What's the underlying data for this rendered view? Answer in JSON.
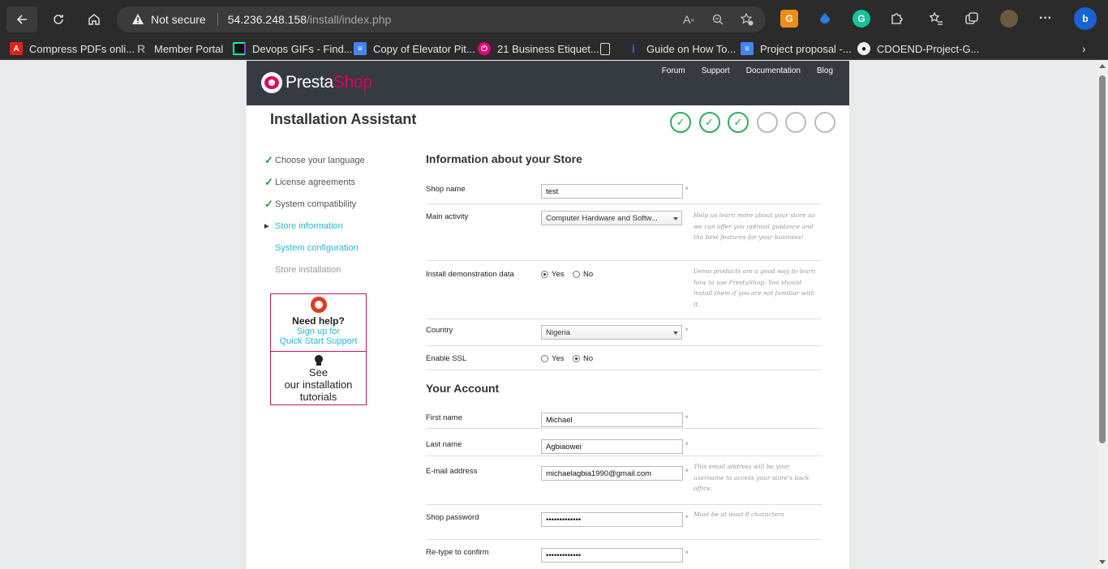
{
  "browser": {
    "security_label": "Not secure",
    "url_host": "54.236.248.158",
    "url_path": "/install/index.php",
    "bookmarks": [
      {
        "label": "Compress PDFs onli...",
        "icon": "acrobat-icon",
        "color": "#e0201a"
      },
      {
        "label": "Member Portal",
        "icon": "r-logo-icon",
        "color": "#555555"
      },
      {
        "label": "Devops GIFs - Find...",
        "icon": "giphy-icon",
        "color": "#1a1a1a"
      },
      {
        "label": "Copy of Elevator Pit...",
        "icon": "docs-icon",
        "color": "#4285f4"
      },
      {
        "label": "21 Business Etiquet...",
        "icon": "power-icon",
        "color": "#e6007e"
      },
      {
        "label": "",
        "icon": "file-icon",
        "color": "#2b2b2b"
      },
      {
        "label": "Guide on How To...",
        "icon": "info-icon",
        "color": "#1a73e8"
      },
      {
        "label": "Project proposal -...",
        "icon": "docs-icon",
        "color": "#4285f4"
      },
      {
        "label": "CDOEND-Project-G...",
        "icon": "github-icon",
        "color": "#f0f0f0"
      }
    ]
  },
  "header": {
    "logo_part1": "Presta",
    "logo_part2": "Shop",
    "links": [
      "Forum",
      "Support",
      "Documentation",
      "Blog"
    ]
  },
  "page_title": "Installation Assistant",
  "progress": {
    "completed_steps": 3,
    "total_steps": 6
  },
  "sidenav": [
    {
      "label": "Choose your language",
      "state": "done"
    },
    {
      "label": "License agreements",
      "state": "done"
    },
    {
      "label": "System compatibility",
      "state": "done"
    },
    {
      "label": "Store information",
      "state": "current"
    },
    {
      "label": "System configuration",
      "state": "next"
    },
    {
      "label": "Store installation",
      "state": "later"
    }
  ],
  "help": {
    "title": "Need help?",
    "link_line1": "Sign up for",
    "link_line2": "Quick Start Support",
    "tutorial_line1": "See",
    "tutorial_line2": "our installation",
    "tutorial_line3": "tutorials"
  },
  "store_section": {
    "title": "Information about your Store",
    "shop_name_label": "Shop name",
    "shop_name_value": "test",
    "main_activity_label": "Main activity",
    "main_activity_value": "Computer Hardware and Softw...",
    "main_activity_hint": "Help us learn more about your store so we can offer you optimal guidance and the best features for your business!",
    "demo_label": "Install demonstration data",
    "demo_yes": "Yes",
    "demo_no": "No",
    "demo_selected": "Yes",
    "demo_hint": "Demo products are a good way to learn how to use PrestaShop. You should install them if you are not familiar with it.",
    "country_label": "Country",
    "country_value": "Nigeria",
    "ssl_label": "Enable SSL",
    "ssl_yes": "Yes",
    "ssl_no": "No",
    "ssl_selected": "No"
  },
  "account_section": {
    "title": "Your Account",
    "first_name_label": "First name",
    "first_name_value": "Michael",
    "last_name_label": "Last name",
    "last_name_value": "Agbiaowei",
    "email_label": "E-mail address",
    "email_value": "michaelagbia1990@gmail.com",
    "email_hint": "This email address will be your username to access your store's back office.",
    "password_label": "Shop password",
    "password_value": "•••••••••••••",
    "password_hint": "Must be at least 8 characters",
    "confirm_label": "Re-type to confirm",
    "confirm_value": "•••••••••••••"
  },
  "required_mark": "*"
}
